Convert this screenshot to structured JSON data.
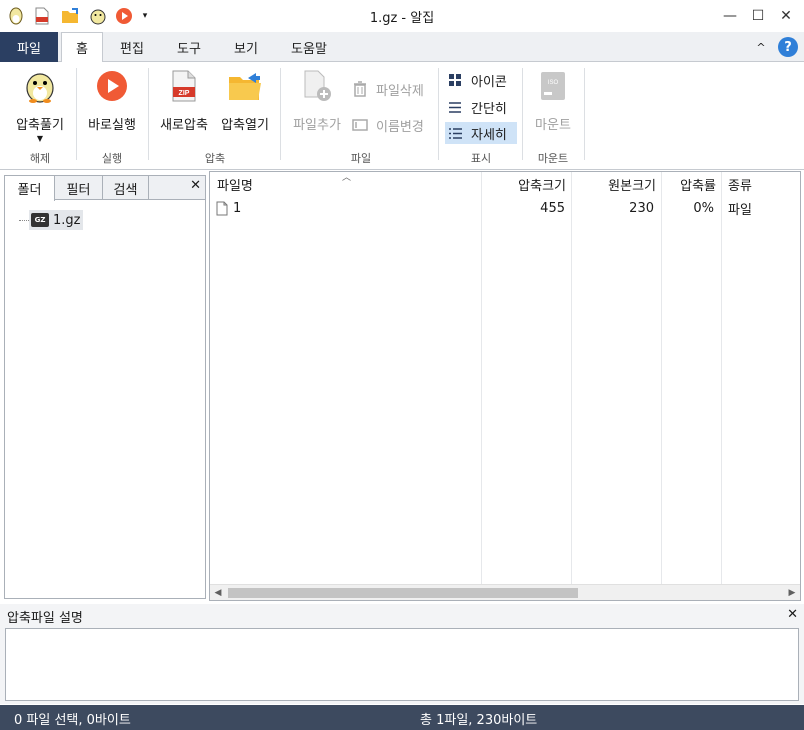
{
  "window": {
    "title": "1.gz - 알집",
    "minimize": "—",
    "maximize": "☐",
    "close": "✕"
  },
  "menu": {
    "file": "파일",
    "tabs": [
      "홈",
      "편집",
      "도구",
      "보기",
      "도움말"
    ],
    "active_tab": "홈",
    "collapse": "^",
    "help": "?"
  },
  "ribbon": {
    "extract": {
      "label": "압축풀기",
      "icon": "alzip-mascot-icon",
      "group": "해제"
    },
    "run": {
      "label": "바로실행",
      "icon": "play-icon",
      "group": "실행"
    },
    "new_archive": {
      "label": "새로압축",
      "icon": "zip-file-icon"
    },
    "open_archive": {
      "label": "압축열기",
      "icon": "folder-open-icon",
      "group": "압축"
    },
    "add_file": {
      "label": "파일추가",
      "icon": "add-file-icon"
    },
    "delete_file": {
      "label": "파일삭제",
      "icon": "trash-icon"
    },
    "rename": {
      "label": "이름변경",
      "icon": "rename-icon",
      "group": "파일"
    },
    "view_icon": {
      "label": "아이콘",
      "icon": "grid-icon"
    },
    "view_list": {
      "label": "간단히",
      "icon": "list-icon"
    },
    "view_detail": {
      "label": "자세히",
      "icon": "detail-list-icon",
      "group": "표시"
    },
    "mount": {
      "label": "마운트",
      "icon": "iso-disk-icon",
      "group": "마운트",
      "iso": "ISO"
    },
    "zip_badge": "ZIP"
  },
  "left_panel": {
    "tabs": [
      "폴더",
      "필터",
      "검색"
    ],
    "active_tab": "폴더",
    "tree": [
      {
        "label": "1.gz",
        "badge": "GZ"
      }
    ]
  },
  "file_list": {
    "columns": [
      "파일명",
      "압축크기",
      "원본크기",
      "압축률",
      "종류"
    ],
    "rows": [
      {
        "name": "1",
        "compressed": "455",
        "original": "230",
        "ratio": "0%",
        "type": "파일"
      }
    ]
  },
  "description": {
    "title": "압축파일 설명",
    "close": "✕"
  },
  "status": {
    "left": "0 파일 선택,  0바이트",
    "right": "총 1파일,  230바이트"
  },
  "colors": {
    "file_tab": "#2b3f62",
    "status_bar": "#3d4a5f",
    "play": "#f05a35",
    "folder": "#f5b731",
    "selected": "#cfe3f7",
    "help": "#2f7fd8"
  }
}
